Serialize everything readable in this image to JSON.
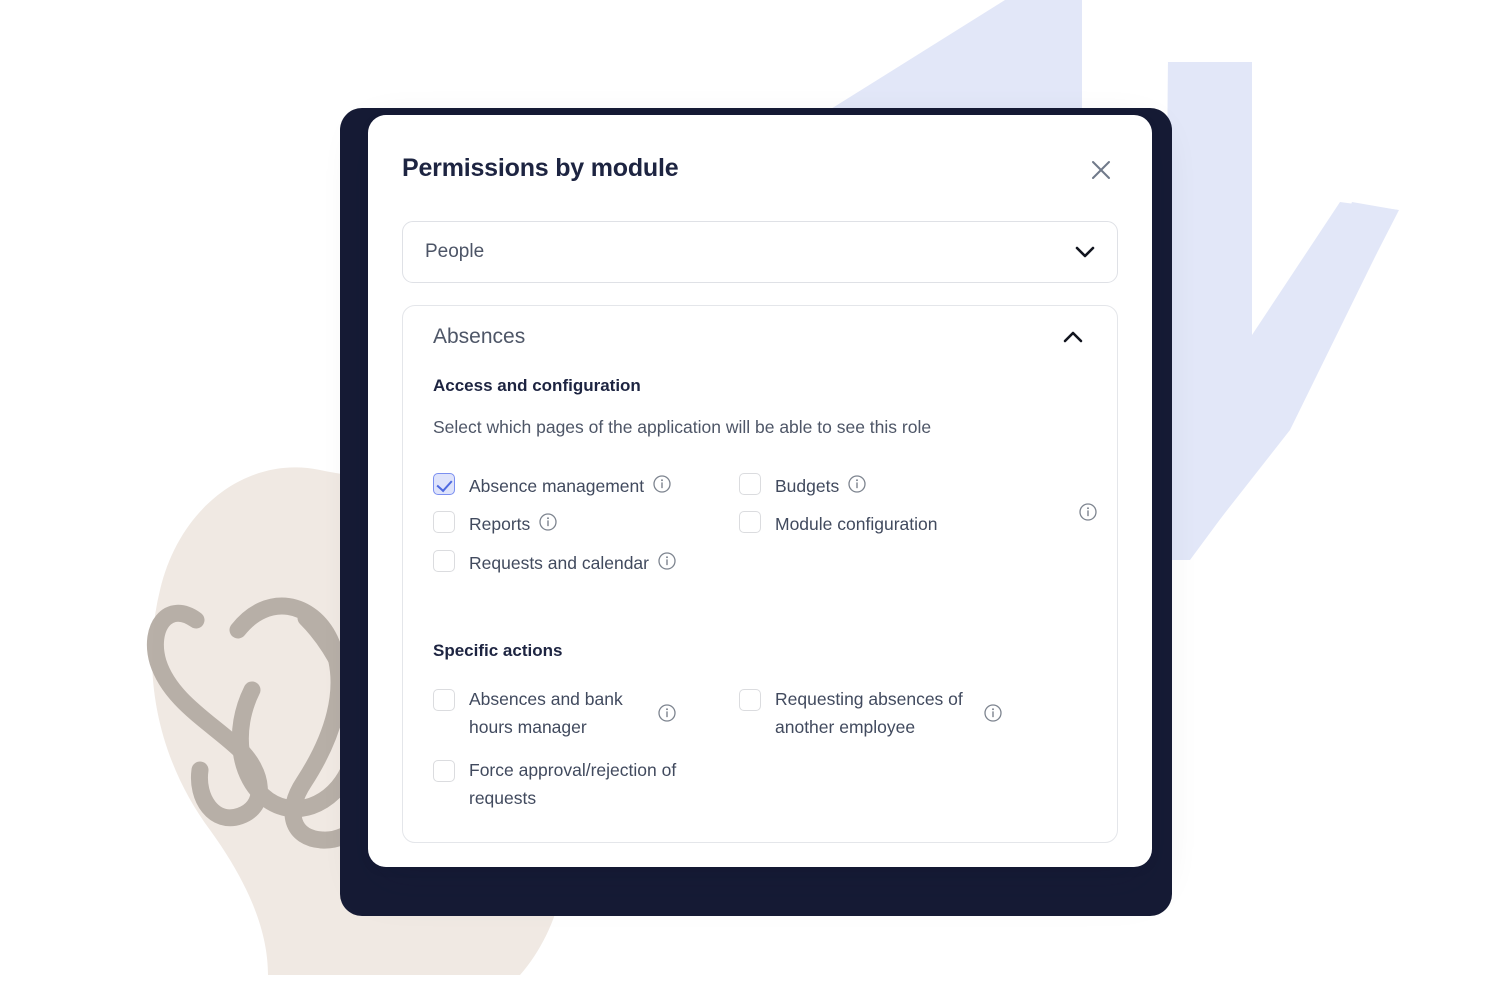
{
  "modal": {
    "title": "Permissions by module",
    "close_icon": "close-icon"
  },
  "module_select": {
    "value": "People",
    "chevron_icon": "chevron-down-icon"
  },
  "accordion": {
    "title": "Absences",
    "chevron_icon": "chevron-up-icon",
    "expanded": true
  },
  "access_section": {
    "heading": "Access and configuration",
    "description": "Select which pages of the application will be able to see this role",
    "options": [
      {
        "label": "Absence management",
        "checked": true,
        "info": "info-icon"
      },
      {
        "label": "Budgets",
        "checked": false,
        "info": "info-icon"
      },
      {
        "label": "Reports",
        "checked": false,
        "info": "info-icon"
      },
      {
        "label": "Module configuration",
        "checked": false,
        "info": "info-icon"
      },
      {
        "label": "Requests and calendar",
        "checked": false,
        "info": "info-icon"
      }
    ]
  },
  "specific_section": {
    "heading": "Specific actions",
    "options": [
      {
        "label": "Absences and bank hours manager",
        "checked": false,
        "info": "info-icon"
      },
      {
        "label": "Requesting absences of another employee",
        "checked": false,
        "info": "info-icon"
      },
      {
        "label": "Force approval/rejection of requests",
        "checked": false,
        "info": "info-icon"
      }
    ]
  },
  "colors": {
    "accent_blue": "#4f6ae0",
    "checkbox_checked_fill": "#dee3fb",
    "title_navy": "#1d2441",
    "backdrop_navy": "#161b35",
    "decor_blue": "#e2e7f8",
    "decor_beige": "#f0e9e3",
    "decor_taupe": "#b5aca4",
    "border_gray": "#dfe1e6"
  }
}
